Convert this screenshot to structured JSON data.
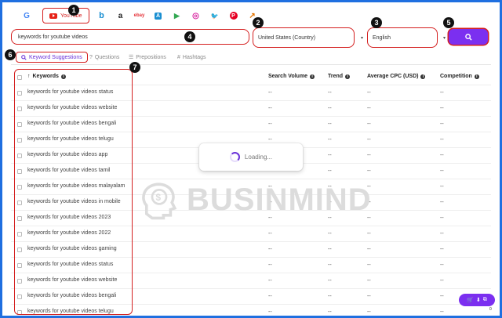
{
  "sources": {
    "google": "G",
    "youtube_label": "YouTube",
    "bing": "b",
    "amazon": "a",
    "ebay": "ebay",
    "appstore": "A",
    "play": "▶",
    "instagram": "◎",
    "twitter": "🐦",
    "pinterest": "P",
    "trends": "↗"
  },
  "search": {
    "keyword_value": "keywords for youtube videos",
    "country_value": "United States (Country)",
    "language_value": "English"
  },
  "subtabs": {
    "keyword_suggestions": "Keyword Suggestions",
    "questions": "Questions",
    "prepositions": "Prepositions",
    "hashtags": "Hashtags"
  },
  "table": {
    "headers": {
      "sort_arrow": "↑",
      "keywords": "Keywords",
      "search_volume": "Search Volume",
      "trend": "Trend",
      "cpc": "Average CPC (USD)",
      "competition": "Competition"
    },
    "placeholder": "--",
    "rows": [
      "keywords for youtube videos status",
      "keywords for youtube videos website",
      "keywords for youtube videos bengali",
      "keywords for youtube videos telugu",
      "keywords for youtube videos app",
      "keywords for youtube videos tamil",
      "keywords for youtube videos malayalam",
      "keywords for youtube videos in mobile",
      "keywords for youtube videos 2023",
      "keywords for youtube videos 2022",
      "keywords for youtube videos gaming",
      "keywords for youtube videos status",
      "keywords for youtube videos website",
      "keywords for youtube videos bengali",
      "keywords for youtube videos telugu"
    ]
  },
  "loading_text": "Loading...",
  "watermark_text": "BUSINMIND",
  "badges": [
    "1",
    "2",
    "3",
    "4",
    "5",
    "6",
    "7"
  ],
  "cart": {
    "count": "0"
  },
  "colors": {
    "accent": "#7b2ff0",
    "annotation": "#d41f1f",
    "frame": "#1f6fe0"
  }
}
